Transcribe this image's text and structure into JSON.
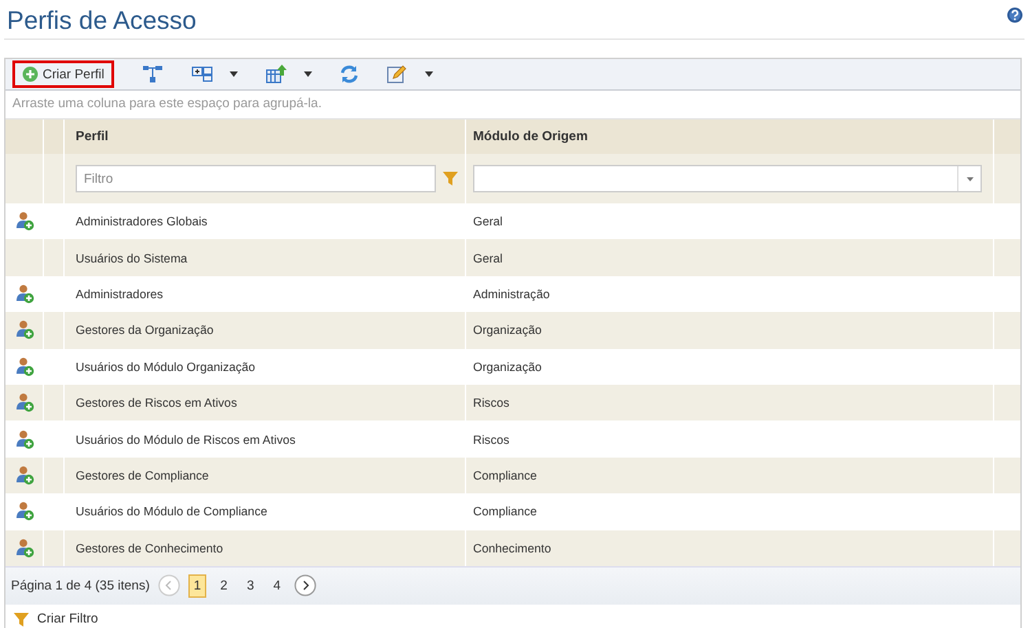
{
  "page": {
    "title": "Perfis de Acesso"
  },
  "toolbar": {
    "create_button": {
      "label": "Criar Perfil",
      "highlighted": true
    }
  },
  "group_hint": "Arraste uma coluna para este espaço para agrupá-la.",
  "table": {
    "columns": [
      "Perfil",
      "Módulo de Origem"
    ],
    "filter": {
      "placeholder": "Filtro"
    },
    "rows": [
      {
        "profile": "Administradores Globais",
        "module": "Geral",
        "has_icon": true
      },
      {
        "profile": "Usuários do Sistema",
        "module": "Geral",
        "has_icon": false
      },
      {
        "profile": "Administradores",
        "module": "Administração",
        "has_icon": true
      },
      {
        "profile": "Gestores da Organização",
        "module": "Organização",
        "has_icon": true
      },
      {
        "profile": "Usuários do Módulo Organização",
        "module": "Organização",
        "has_icon": true
      },
      {
        "profile": "Gestores de Riscos em Ativos",
        "module": "Riscos",
        "has_icon": true
      },
      {
        "profile": "Usuários do Módulo de Riscos em Ativos",
        "module": "Riscos",
        "has_icon": true
      },
      {
        "profile": "Gestores de Compliance",
        "module": "Compliance",
        "has_icon": true
      },
      {
        "profile": "Usuários do Módulo de Compliance",
        "module": "Compliance",
        "has_icon": true
      },
      {
        "profile": "Gestores de Conhecimento",
        "module": "Conhecimento",
        "has_icon": true
      }
    ]
  },
  "pager": {
    "summary": "Página 1 de 4 (35 itens)",
    "pages": [
      {
        "label": "1",
        "selected": true
      },
      {
        "label": "2",
        "selected": false
      },
      {
        "label": "3",
        "selected": false
      },
      {
        "label": "4",
        "selected": false
      }
    ]
  },
  "footer": {
    "create_filter": "Criar Filtro"
  }
}
